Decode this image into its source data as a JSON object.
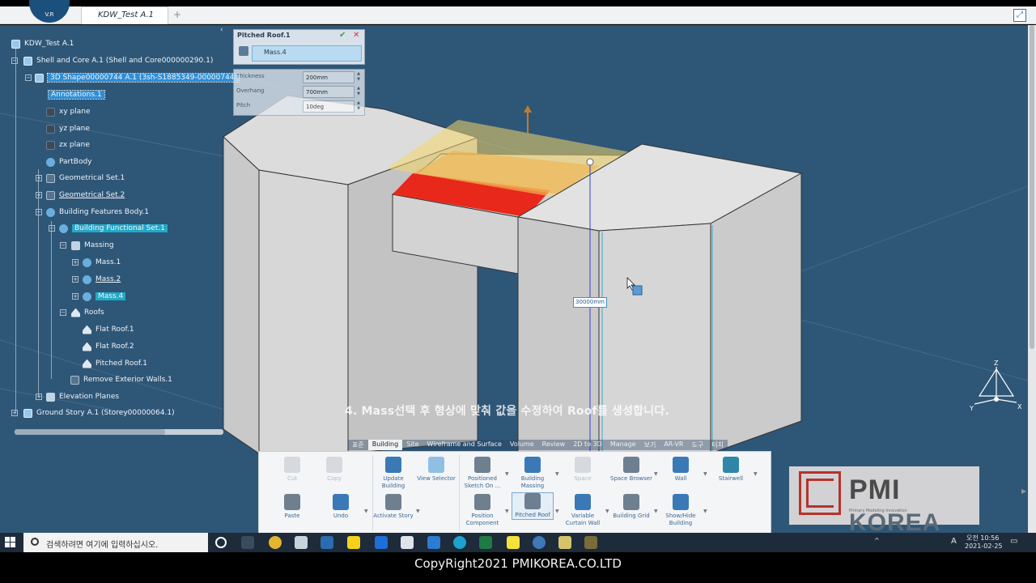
{
  "window": {
    "doc_tab": "KDW_Test A.1",
    "new_tab": "+",
    "logo_text": "V.R",
    "fullscreen_icon": "expand-icon"
  },
  "tree": {
    "collapse_glyph": "‹",
    "items": [
      {
        "label": "KDW_Test A.1"
      },
      {
        "label": "Shell and Core A.1 (Shell and Core000000290.1)"
      },
      {
        "label": "3D Shape00000744 A.1 (3sh-S1885349-00000744."
      },
      {
        "label": "Annotations.1"
      },
      {
        "label": "xy plane"
      },
      {
        "label": "yz plane"
      },
      {
        "label": "zx plane"
      },
      {
        "label": "PartBody"
      },
      {
        "label": "Geometrical Set.1"
      },
      {
        "label": "Geometrical Set.2"
      },
      {
        "label": "Building Features Body.1"
      },
      {
        "label": "Building Functional Set.1"
      },
      {
        "label": "Massing"
      },
      {
        "label": "Mass.1"
      },
      {
        "label": "Mass.2"
      },
      {
        "label": "Mass.4"
      },
      {
        "label": "Roofs"
      },
      {
        "label": "Flat Roof.1"
      },
      {
        "label": "Flat Roof.2"
      },
      {
        "label": "Pitched Roof.1"
      },
      {
        "label": "Remove Exterior Walls.1"
      },
      {
        "label": "Elevation Planes"
      },
      {
        "label": "Ground Story A.1 (Storey00000064.1)"
      }
    ]
  },
  "roof_panel": {
    "title": "Pitched Roof.1",
    "ok": "✔",
    "cancel": "✕",
    "selection": "Mass.4"
  },
  "params": [
    {
      "label": "Thickness",
      "value": "200mm"
    },
    {
      "label": "Overhang",
      "value": "700mm"
    },
    {
      "label": "Pitch",
      "value": "10deg"
    }
  ],
  "dimension_label": "30000mm",
  "subtitle": "4. Mass선택 후 형상에 맞춰 값을 수정하여 Roof를 생성합니다.",
  "ribbon": {
    "tabs": [
      "표준",
      "Building",
      "Site",
      "Wireframe and Surface",
      "Volume",
      "Review",
      "2D to 3D",
      "Manage",
      "보기",
      "AR-VR",
      "도구",
      "터치"
    ],
    "active_tab": "Building",
    "buttons": {
      "cut": "Cut",
      "copy": "Copy",
      "paste": "Paste",
      "undo": "Undo",
      "update_building": "Update Building",
      "view_selector": "View Selector",
      "activate_story": "Activate Story",
      "positioned_sketch": "Positioned Sketch On ...",
      "building_massing": "Building Massing",
      "space": "Space",
      "space_browser": "Space Browser",
      "wall": "Wall",
      "stairwell": "Stairwell",
      "position_component": "Position Component",
      "pitched_roof": "Pitched Roof",
      "variable_curtain_wall": "Variable Curtain Wall",
      "building_grid": "Building Grid",
      "show_hide_building": "Show/Hide Building"
    }
  },
  "gizmo": {
    "x": "X",
    "y": "Y",
    "z": "Z"
  },
  "logo": {
    "word": "PMI",
    "suffix": "KOREA",
    "tagline": "Primary Modeling Innovation"
  },
  "taskbar": {
    "search_placeholder": "검색하려면 여기에 입력하십시오.",
    "am_pm": "오전",
    "time": "10:56",
    "date": "2021-02-25",
    "ime": "A"
  },
  "copyright": "CopyRight2021 PMIKOREA.CO.LTD",
  "colors": {
    "viewport_bg": "#2e5677",
    "selection_red": "#e8281a",
    "roof_yellow": "#f4d76a"
  }
}
